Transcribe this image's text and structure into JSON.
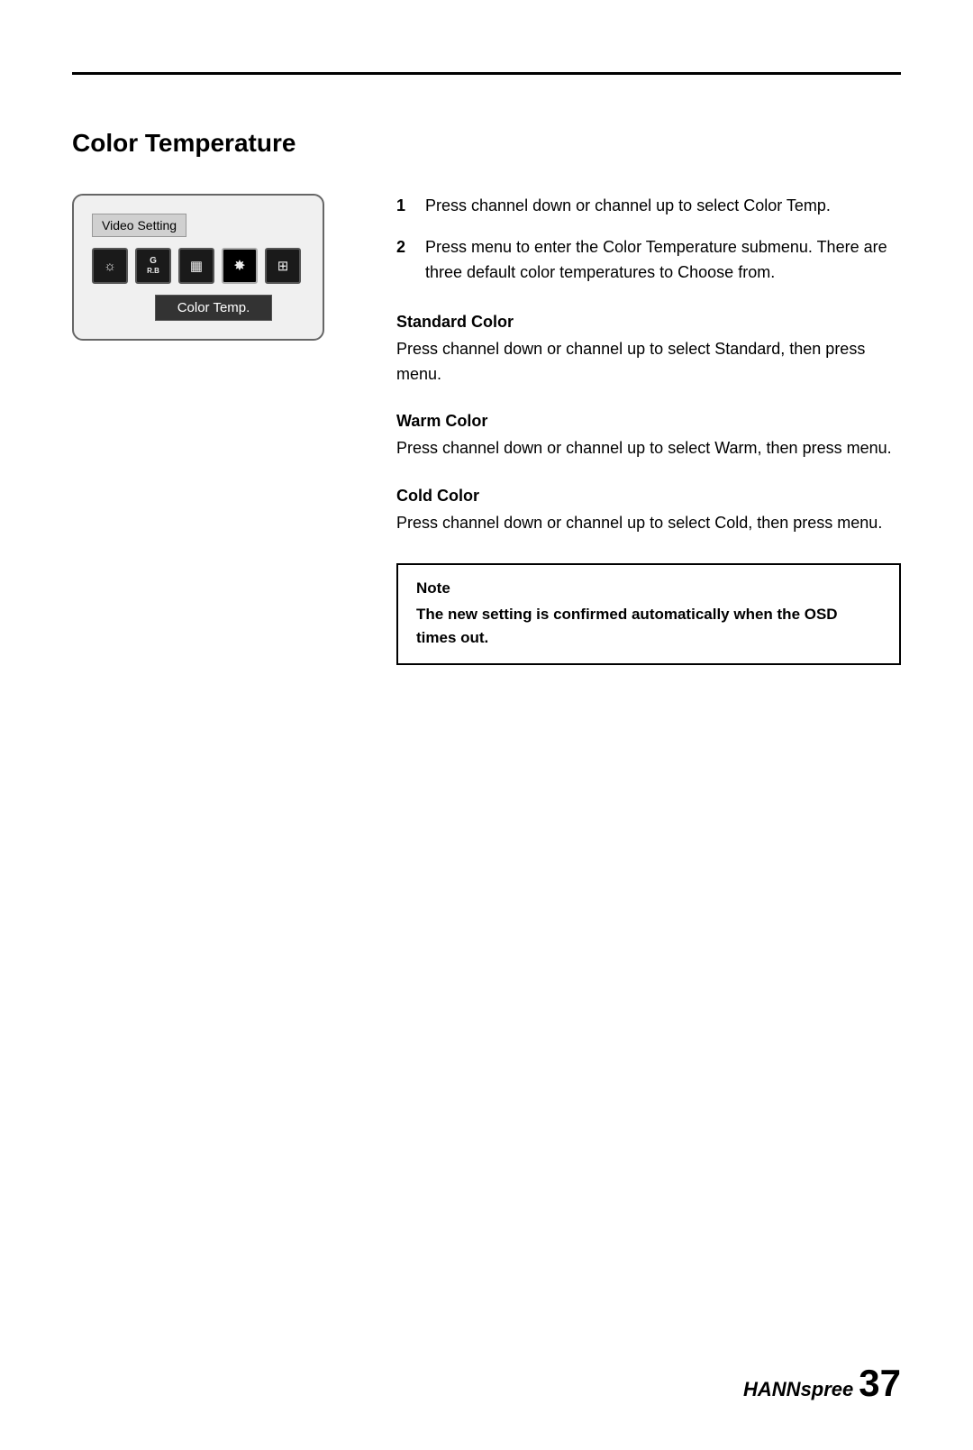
{
  "page": {
    "section_title": "Color Temperature",
    "top_rule": true
  },
  "osd": {
    "menu_label": "Video Setting",
    "selected_item": "Color  Temp.",
    "icons": [
      {
        "id": "brightness",
        "symbol": "☀",
        "active": false
      },
      {
        "id": "gb",
        "symbol": "G\nRB",
        "active": false
      },
      {
        "id": "contrast",
        "symbol": "▣",
        "active": false
      },
      {
        "id": "color",
        "symbol": "✿",
        "active": true
      },
      {
        "id": "extra",
        "symbol": "⊡",
        "active": false
      }
    ]
  },
  "steps": [
    {
      "num": "1",
      "text": "Press channel down or channel up to select Color Temp."
    },
    {
      "num": "2",
      "text": "Press menu to enter the Color Temperature submenu. There are three default color temperatures to Choose from."
    }
  ],
  "subsections": [
    {
      "id": "standard",
      "title": "Standard Color",
      "text": "Press channel down or channel up to select Standard, then press menu."
    },
    {
      "id": "warm",
      "title": "Warm Color",
      "text": "Press channel down or channel up to select Warm, then press menu."
    },
    {
      "id": "cold",
      "title": "Cold Color",
      "text": "Press channel down or channel up to select Cold, then press menu."
    }
  ],
  "note": {
    "label": "Note",
    "text": "The new setting is confirmed automatically when the OSD times out."
  },
  "footer": {
    "brand_hann": "HANN",
    "brand_spread": "spree",
    "page_number": "37"
  }
}
